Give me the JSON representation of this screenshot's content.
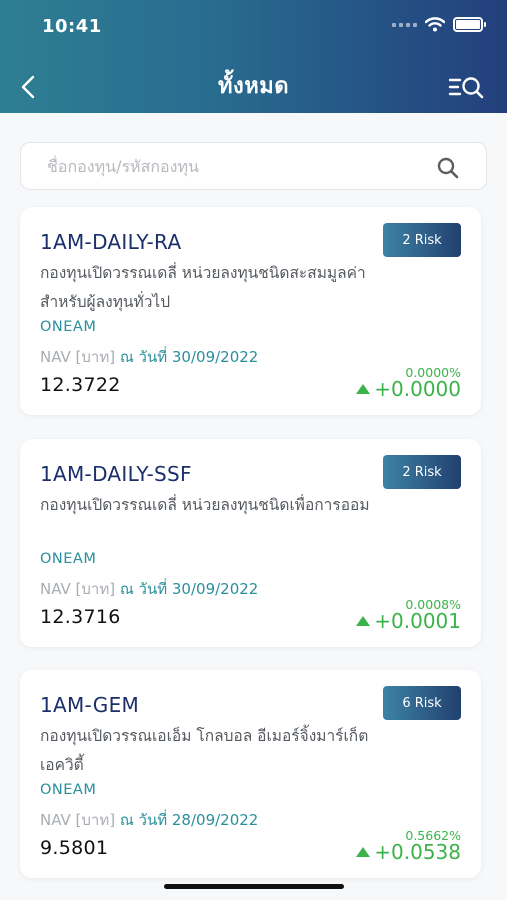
{
  "status_bar": {
    "time": "10:41"
  },
  "header": {
    "title": "ทั้งหมด"
  },
  "search": {
    "placeholder": "ชื่อกองทุน/รหัสกองทุน"
  },
  "colors": {
    "accent_green": "#3cb34a",
    "teal": "#2a8f9b",
    "navy": "#1b2f6b"
  },
  "funds": [
    {
      "code": "1AM-DAILY-RA",
      "risk": "2 Risk",
      "name": "กองทุนเปิดวรรณเดลี่ หน่วยลงทุนชนิดสะสมมูลค่า สำหรับผู้ลงทุนทั่วไป",
      "amc": "ONEAM",
      "nav_label": "NAV [บาท]",
      "nav_date": "ณ วันที่ 30/09/2022",
      "nav": "12.3722",
      "change_pct": "0.0000%",
      "change": "+0.0000"
    },
    {
      "code": "1AM-DAILY-SSF",
      "risk": "2 Risk",
      "name": "กองทุนเปิดวรรณเดลี่ หน่วยลงทุนชนิดเพื่อการออม",
      "amc": "ONEAM",
      "nav_label": "NAV [บาท]",
      "nav_date": "ณ วันที่ 30/09/2022",
      "nav": "12.3716",
      "change_pct": "0.0008%",
      "change": "+0.0001"
    },
    {
      "code": "1AM-GEM",
      "risk": "6 Risk",
      "name": "กองทุนเปิดวรรณเอเอ็ม โกลบอล อีเมอร์จิ้งมาร์เก็ต เอควิตี้",
      "amc": "ONEAM",
      "nav_label": "NAV [บาท]",
      "nav_date": "ณ วันที่ 28/09/2022",
      "nav": "9.5801",
      "change_pct": "0.5662%",
      "change": "+0.0538"
    }
  ]
}
